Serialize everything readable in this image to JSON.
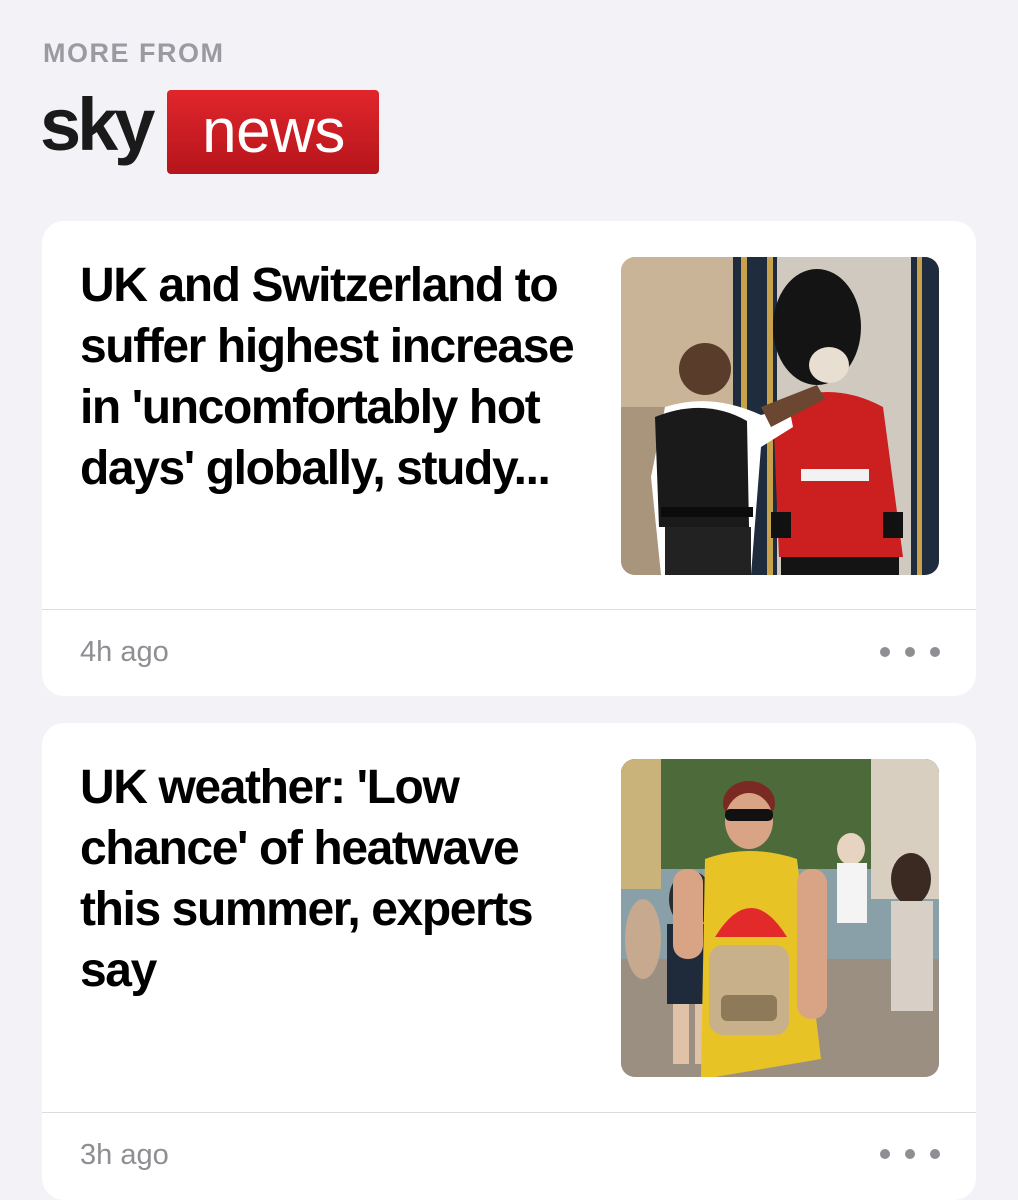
{
  "section": {
    "label": "MORE FROM"
  },
  "brand": {
    "sky": "sky",
    "news": "news",
    "colors": {
      "sky_text": "#1a1a1a",
      "news_bg": "#d11f26",
      "news_text": "#ffffff"
    }
  },
  "articles": [
    {
      "headline": "UK and Switzerland to suffer highest increase in 'uncomfortably hot days' globally, study...",
      "time": "4h ago",
      "image": "police-officer-wiping-face-of-queens-guard",
      "more_icon": "ellipsis-icon"
    },
    {
      "headline": "UK weather: 'Low chance' of heatwave this summer, experts say",
      "time": "3h ago",
      "image": "woman-in-yellow-dress-holding-red-fan-in-crowd",
      "more_icon": "ellipsis-icon"
    }
  ],
  "colors": {
    "page_bg": "#f2f2f7",
    "card_bg": "#ffffff",
    "meta_text": "#8e8e93",
    "section_label": "#9a9aa0"
  }
}
